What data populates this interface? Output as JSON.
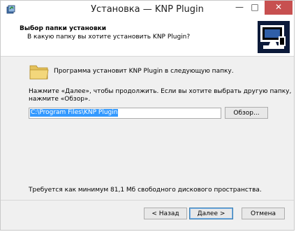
{
  "window": {
    "title": "Установка — KNP Plugin",
    "min_glyph": "—",
    "max_glyph": "□",
    "close_glyph": "✕"
  },
  "header": {
    "title": "Выбор папки установки",
    "subtitle": "В какую папку вы хотите установить KNP Plugin?"
  },
  "body": {
    "info": "Программа установит KNP Plugin в следующую папку.",
    "instruction_line1": "Нажмите «Далее», чтобы продолжить. Если вы хотите выбрать другую папку,",
    "instruction_line2": "нажмите «Обзор».",
    "path_value": "C:\\Program Files\\KNP Plugin",
    "browse_label": "Обзор...",
    "disk_space": "Требуется как минимум 81,1 Мб свободного дискового пространства."
  },
  "buttons": {
    "back": "< Назад",
    "next": "Далее >",
    "cancel": "Отмена"
  }
}
